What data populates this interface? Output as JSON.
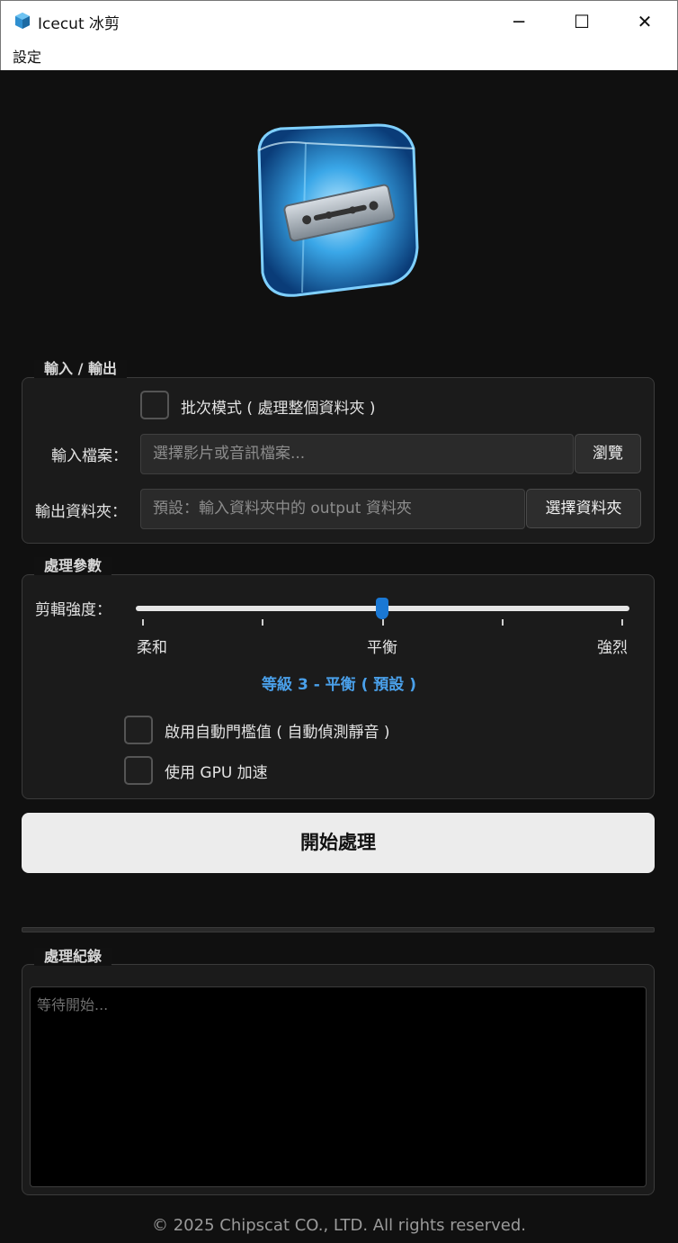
{
  "window": {
    "title": "Icecut 冰剪",
    "minimize_glyph": "─",
    "maximize_glyph": "☐",
    "close_glyph": "✕"
  },
  "menu": {
    "settings": "設定"
  },
  "io_group": {
    "title": "輸入 / 輸出",
    "batch_checkbox_label": "批次模式 ( 處理整個資料夾 )",
    "batch_checked": false,
    "input_file_label": "輸入檔案：",
    "input_file_placeholder": "選擇影片或音訊檔案...",
    "browse_button": "瀏覽",
    "output_folder_label": "輸出資料夾：",
    "output_folder_placeholder": "預設：輸入資料夾中的 output 資料夾",
    "choose_folder_button": "選擇資料夾"
  },
  "params_group": {
    "title": "處理參數",
    "strength_label": "剪輯強度：",
    "slider": {
      "min": 1,
      "max": 5,
      "value": 3
    },
    "tick_labels": {
      "low": "柔和",
      "mid": "平衡",
      "high": "強烈"
    },
    "level_text": "等級 3 - 平衡 ( 預設 )",
    "auto_threshold_label": "啟用自動門檻值 ( 自動偵測靜音 )",
    "auto_threshold_checked": false,
    "gpu_label": "使用 GPU 加速",
    "gpu_checked": false
  },
  "start_button": "開始處理",
  "log_group": {
    "title": "處理紀錄",
    "placeholder": "等待開始..."
  },
  "footer": "© 2025 Chipscat CO., LTD.  All rights reserved.",
  "colors": {
    "accent": "#1a78d4",
    "level_text": "#4aa0ea",
    "background": "#101010"
  },
  "icons": {
    "app": "ice-cube-razor-icon",
    "logo": "ice-cube-razor-logo"
  }
}
